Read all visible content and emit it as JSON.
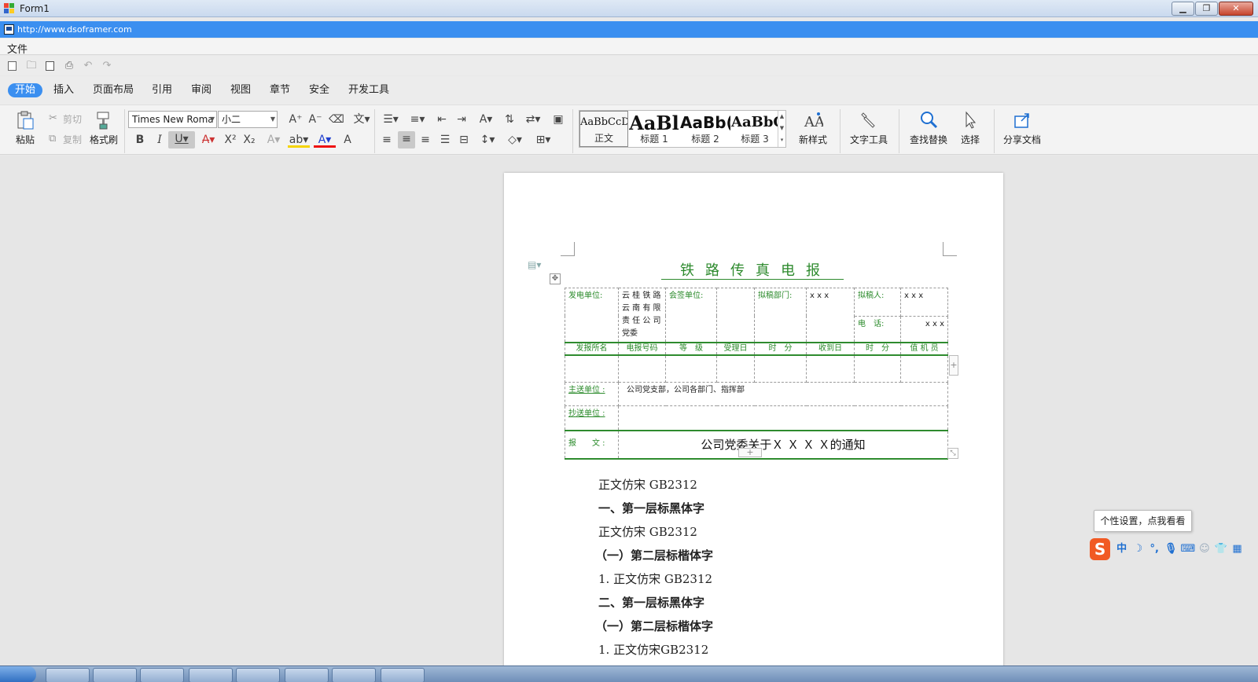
{
  "window": {
    "title": "Form1",
    "url": "http://www.dsoframer.com"
  },
  "menu": {
    "file": "文件"
  },
  "tabs": [
    "开始",
    "插入",
    "页面布局",
    "引用",
    "审阅",
    "视图",
    "章节",
    "安全",
    "开发工具"
  ],
  "ribbon": {
    "paste": "粘贴",
    "cut": "剪切",
    "copy": "复制",
    "format_painter": "格式刷",
    "font_name": "Times New Roma",
    "font_size": "小二",
    "styles": [
      {
        "preview": "AaBbCcDd",
        "name": "正文"
      },
      {
        "preview": "AaBl",
        "name": "标题 1"
      },
      {
        "preview": "AaBb(",
        "name": "标题 2"
      },
      {
        "preview": "AaBbC",
        "name": "标题 3"
      }
    ],
    "new_style": "新样式",
    "text_tools": "文字工具",
    "find_replace": "查找替换",
    "select": "选择",
    "share_doc": "分享文档"
  },
  "document": {
    "title": "铁路传真电报",
    "table": {
      "sender_label": "发电单位:",
      "sender_value": [
        "云 桂 铁 路",
        "云 南 有 限",
        "责 任 公 司",
        "党委"
      ],
      "cosign_label": "会签单位:",
      "draft_dept_label": "拟稿部门:",
      "draft_dept_value": "x x x",
      "drafter_label": "拟稿人:",
      "drafter_value": "x x x",
      "phone_label": "电　话:",
      "phone_value": "x x x",
      "headers": [
        "发报所名",
        "电报号码",
        "等　级",
        "受理日",
        "时　分",
        "收到日",
        "时　分",
        "值 机 员"
      ],
      "main_recipient_label": "主送单位 :",
      "main_recipient_value": "公司党支部，公司各部门、指挥部",
      "cc_label": "抄送单位 :",
      "message_label": "报　　文 :",
      "message_value": "公司党委关于Ｘ Ｘ Ｘ Ｘ的通知"
    },
    "lines": [
      {
        "text": "正文仿宋 GB2312",
        "bold": false
      },
      {
        "text": "一、第一层标黑体字",
        "bold": true
      },
      {
        "text": "正文仿宋 GB2312",
        "bold": false
      },
      {
        "text": "（一）第二层标楷体字",
        "bold": true
      },
      {
        "text": "1.  正文仿宋 GB2312",
        "bold": false
      },
      {
        "text": "二、第一层标黑体字",
        "bold": true
      },
      {
        "text": "（一）第二层标楷体字",
        "bold": true
      },
      {
        "text": "1.  正文仿宋GB2312",
        "bold": false
      }
    ]
  },
  "ime": {
    "tooltip": "个性设置，点我看看",
    "mode": "中"
  },
  "colors": {
    "accent": "#3b8ff0",
    "green": "#2d8a2d"
  }
}
